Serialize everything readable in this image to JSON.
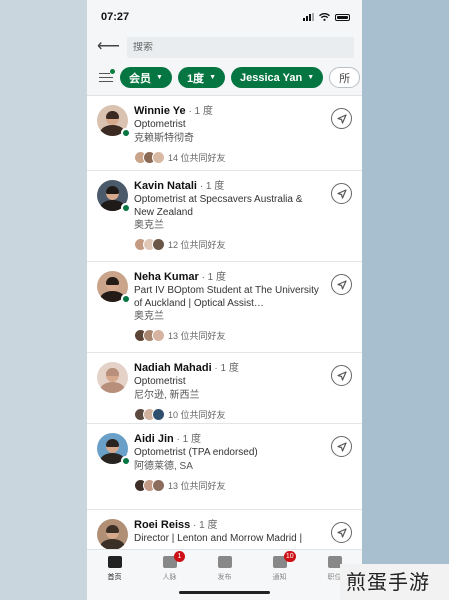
{
  "status": {
    "time": "07:27"
  },
  "search": {
    "placeholder": "搜索"
  },
  "filters": [
    {
      "label": "会员"
    },
    {
      "label": "1度"
    },
    {
      "label": "Jessica Yan"
    },
    {
      "label": "所"
    }
  ],
  "people": [
    {
      "name": "Winnie Ye",
      "degree": "· 1 度",
      "title": "Optometrist",
      "location": "克赖斯特彻奇",
      "mutual": "14 位共同好友",
      "online": true,
      "avatar_colors": [
        "#3a2a22",
        "#d9c2b0"
      ],
      "mini_colors": [
        "#c9a38a",
        "#8a6a55",
        "#d8b9a3"
      ]
    },
    {
      "name": "Kavin Natali",
      "degree": "· 1 度",
      "title": "Optometrist at Specsavers Australia & New Zealand",
      "location": "奥克兰",
      "mutual": "12 位共同好友",
      "online": true,
      "avatar_colors": [
        "#1e1a18",
        "#4a5a6a"
      ],
      "mini_colors": [
        "#c49a82",
        "#e0c8b8",
        "#6b5748"
      ]
    },
    {
      "name": "Neha Kumar",
      "degree": "· 1 度",
      "title": "Part IV BOptom Student at The University of Auckland | Optical Assist…",
      "location": "奥克兰",
      "mutual": "13 位共同好友",
      "online": true,
      "avatar_colors": [
        "#241a16",
        "#caa48a"
      ],
      "mini_colors": [
        "#5b4436",
        "#a7856f",
        "#d6b3a0"
      ]
    },
    {
      "name": "Nadiah Mahadi",
      "degree": "· 1 度",
      "title": "Optometrist",
      "location": "尼尔逊, 新西兰",
      "mutual": "",
      "online": false,
      "avatar_colors": [
        "#b88f7a",
        "#e4d2c8"
      ],
      "mini_colors": []
    },
    {
      "name": "Aidi Jin",
      "degree": "· 1 度",
      "title": "Optometrist (TPA endorsed)",
      "location": "阿德莱德, SA",
      "mutual": "13 位共同好友",
      "online": true,
      "avatar_colors": [
        "#2a2420",
        "#6aa0c8"
      ],
      "mini_colors": [
        "#3d2f28",
        "#c29a86",
        "#8c6d5d"
      ]
    },
    {
      "name": "Roei Reiss",
      "degree": "· 1 度",
      "title": "Director | Lenton and Morrow Madrid |",
      "location": "",
      "mutual": "",
      "online": false,
      "avatar_colors": [
        "#3b2f26",
        "#b08f75"
      ],
      "mini_colors": []
    }
  ],
  "nadiah_mutual": {
    "text": "10 位共同好友",
    "mini_colors": [
      "#5c4a40",
      "#d0b29f",
      "#2f4f6f"
    ]
  },
  "nav": [
    {
      "label": "首页",
      "badge": "",
      "active": true
    },
    {
      "label": "人脉",
      "badge": "1",
      "active": false
    },
    {
      "label": "发布",
      "badge": "",
      "active": false
    },
    {
      "label": "通知",
      "badge": "10",
      "active": false
    },
    {
      "label": "职位",
      "badge": "",
      "active": false
    }
  ],
  "watermark": "煎蛋手游",
  "colors": {
    "accent": "#057642",
    "badge": "#cc1016"
  }
}
